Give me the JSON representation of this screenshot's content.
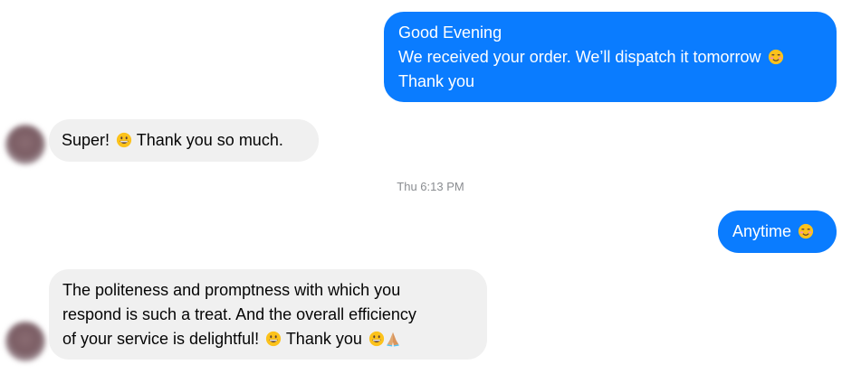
{
  "colors": {
    "outgoing_bubble": "#0a7cff",
    "incoming_bubble": "#f0f0f0",
    "timestamp_text": "#8a8d91"
  },
  "messages": {
    "m1": {
      "line1": "Good Evening",
      "line2": "We received your order. We’ll dispatch it tomorrow",
      "line2_emoji": "smiling-blush-emoji",
      "line3": "Thank you"
    },
    "m2": {
      "text_a": "Super!",
      "emoji_a": "grinning-face-emoji",
      "text_b": "Thank you so much."
    },
    "timestamp": "Thu 6:13 PM",
    "m3": {
      "text": "Anytime",
      "emoji": "smiling-blush-emoji"
    },
    "m4": {
      "line1": "The politeness and promptness with which you",
      "line2": "respond is such a treat. And the overall efficiency",
      "line3_a": "of your service is delightful!",
      "line3_emoji_1": "grinning-face-emoji",
      "line3_b": "Thank you",
      "line3_emoji_2": "grinning-face-emoji",
      "line3_emoji_3": "folded-hands-emoji"
    }
  }
}
